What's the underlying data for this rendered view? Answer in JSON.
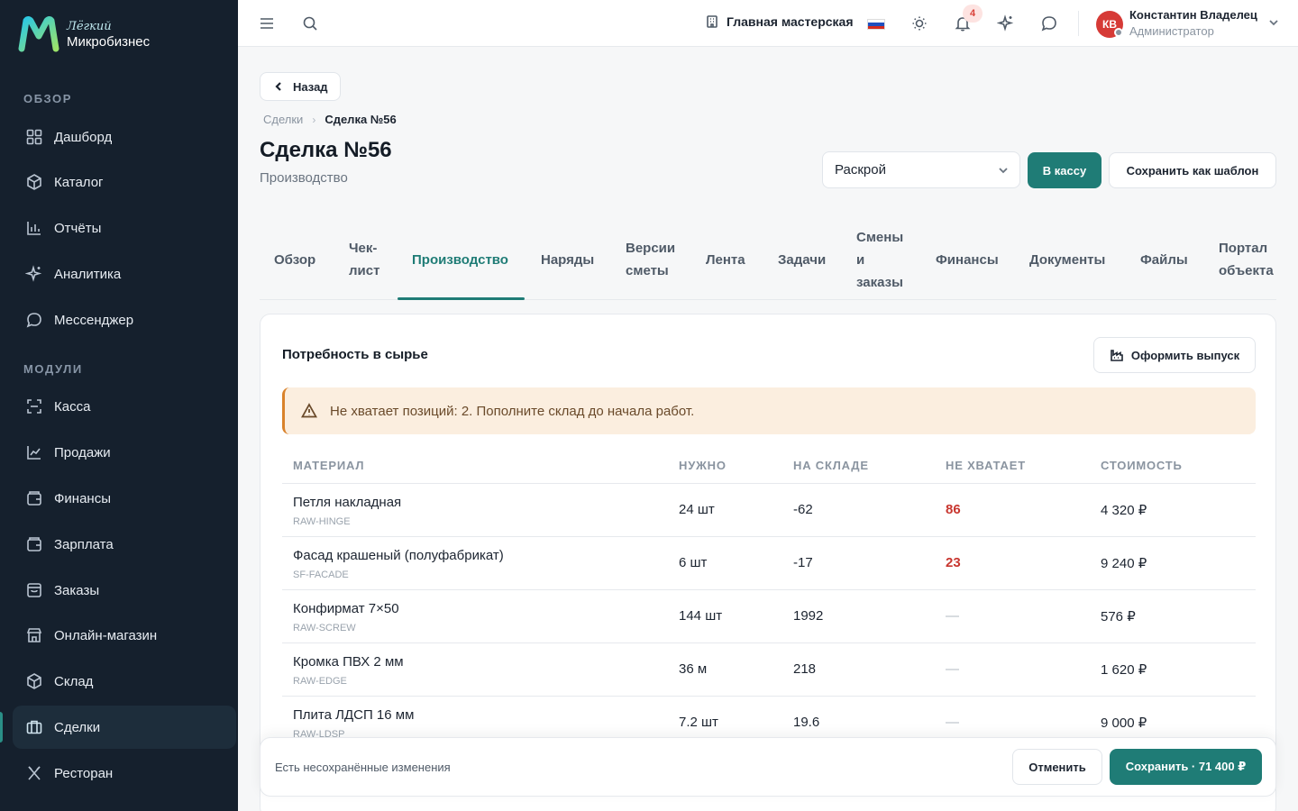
{
  "app": {
    "logo_small": "Лёгкий",
    "logo_big": "Микробизнес"
  },
  "sidebar": {
    "section_overview": "ОБЗОР",
    "section_modules": "МОДУЛИ",
    "items": [
      {
        "label": "Дашборд",
        "icon": "dashboard-icon"
      },
      {
        "label": "Каталог",
        "icon": "catalog-icon"
      },
      {
        "label": "Отчёты",
        "icon": "reports-icon"
      },
      {
        "label": "Аналитика",
        "icon": "sparkles-icon"
      },
      {
        "label": "Мессенджер",
        "icon": "chat-icon"
      },
      {
        "label": "Касса",
        "icon": "scan-icon"
      },
      {
        "label": "Продажи",
        "icon": "sales-chart-icon"
      },
      {
        "label": "Финансы",
        "icon": "wallet-icon"
      },
      {
        "label": "Зарплата",
        "icon": "wallet-icon"
      },
      {
        "label": "Заказы",
        "icon": "inbox-icon"
      },
      {
        "label": "Онлайн-магазин",
        "icon": "store-icon"
      },
      {
        "label": "Склад",
        "icon": "box-icon"
      },
      {
        "label": "Сделки",
        "icon": "briefcase-icon",
        "active": true
      },
      {
        "label": "Ресторан",
        "icon": "utensils-icon"
      }
    ]
  },
  "topbar": {
    "workshop": "Главная мастерская",
    "notifications_count": "4",
    "user_initials": "КВ",
    "user_name": "Константин Владелец",
    "user_role": "Администратор",
    "flag_colors": [
      "#ffffff",
      "#1f4fbf",
      "#d52b1e"
    ]
  },
  "header": {
    "back_label": "Назад",
    "breadcrumb": {
      "parent": "Сделки",
      "current": "Сделка №56"
    },
    "title": "Сделка №56",
    "subtitle": "Производство",
    "select_value": "Раскрой",
    "to_cashier": "В кассу",
    "save_template": "Сохранить как шаблон"
  },
  "tabs": {
    "overview": "Обзор",
    "checklist_1": "Чек-",
    "checklist_2": "лист",
    "production": "Производство",
    "orders": "Наряды",
    "estimate_1": "Версии",
    "estimate_2": "сметы",
    "feed": "Лента",
    "tasks": "Задачи",
    "shifts_1": "Смены",
    "shifts_2": "и",
    "shifts_3": "заказы",
    "finance": "Финансы",
    "documents": "Документы",
    "files": "Файлы",
    "portal_1": "Портал",
    "portal_2": "объекта"
  },
  "materials": {
    "title": "Потребность в сырье",
    "release_button": "Оформить выпуск",
    "alert": "Не хватает позиций: 2. Пополните склад до начала работ.",
    "columns": [
      "МАТЕРИАЛ",
      "НУЖНО",
      "НА СКЛАДЕ",
      "НЕ ХВАТАЕТ",
      "СТОИМОСТЬ"
    ],
    "rows": [
      {
        "name": "Петля накладная",
        "sku": "RAW-HINGE",
        "need": "24 шт",
        "stock": "-62",
        "short": "86",
        "cost": "4 320 ₽"
      },
      {
        "name": "Фасад крашеный (полуфабрикат)",
        "sku": "SF-FACADE",
        "need": "6 шт",
        "stock": "-17",
        "short": "23",
        "cost": "9 240 ₽"
      },
      {
        "name": "Конфирмат 7×50",
        "sku": "RAW-SCREW",
        "need": "144 шт",
        "stock": "1992",
        "short": "—",
        "cost": "576 ₽"
      },
      {
        "name": "Кромка ПВХ 2 мм",
        "sku": "RAW-EDGE",
        "need": "36 м",
        "stock": "218",
        "short": "—",
        "cost": "1 620 ₽"
      },
      {
        "name": "Плита ЛДСП 16 мм",
        "sku": "RAW-LDSP",
        "need": "7.2 шт",
        "stock": "19.6",
        "short": "—",
        "cost": "9 000 ₽"
      }
    ]
  },
  "savebar": {
    "text": "Есть несохранённые изменения",
    "cancel": "Отменить",
    "save": "Сохранить · 71 400 ₽"
  }
}
